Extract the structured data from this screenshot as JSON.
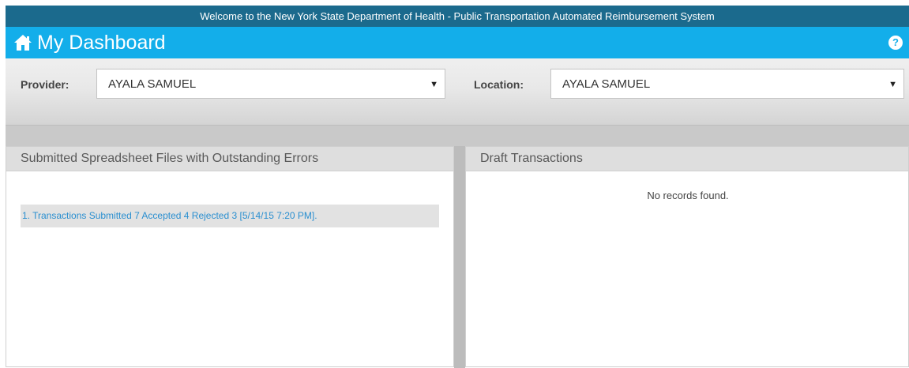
{
  "welcome_bar": {
    "text": "Welcome to the New York State Department of Health - Public Transportation Automated Reimbursement System"
  },
  "header": {
    "title": "My Dashboard",
    "help_label": "?",
    "accent_color": "#13aeea",
    "banner_color": "#1b6a8d"
  },
  "filters": {
    "provider": {
      "label": "Provider:",
      "value": "AYALA SAMUEL"
    },
    "location": {
      "label": "Location:",
      "value": "AYALA SAMUEL"
    },
    "arrow": "▼"
  },
  "panels": {
    "errors": {
      "title": "Submitted Spreadsheet Files with Outstanding Errors",
      "items": [
        {
          "text": "1. Transactions Submitted 7 Accepted 4 Rejected 3 [5/14/15 7:20 PM]."
        }
      ]
    },
    "drafts": {
      "title": "Draft Transactions",
      "empty_message": "No records found."
    }
  },
  "icons": {
    "home": "home-icon",
    "help": "question-circle-icon"
  }
}
